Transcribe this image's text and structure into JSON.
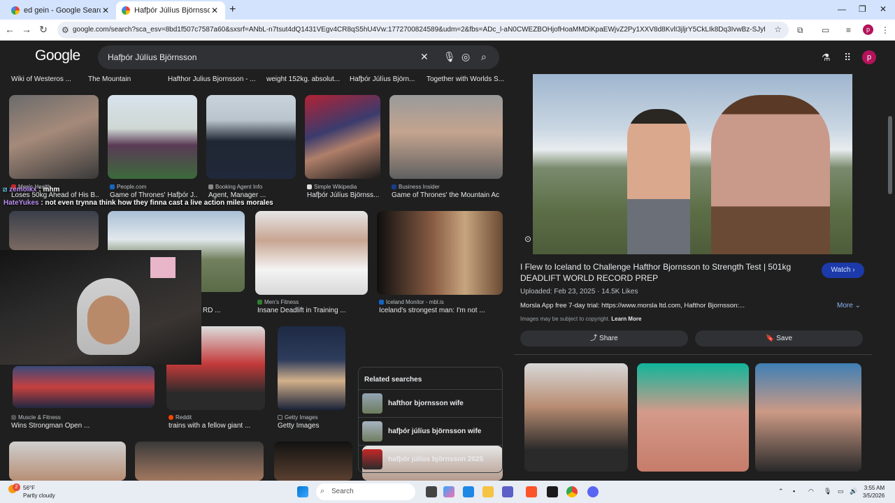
{
  "browser": {
    "tabs": [
      {
        "title": "ed gein - Google Search",
        "close": "✕"
      },
      {
        "title": "Hafþór Júlíus Björnsson - Goog",
        "close": "✕"
      }
    ],
    "new_tab": "+",
    "url": "google.com/search?sca_esv=8bd1f507c7587a60&sxsrf=ANbL-n7tsut4dQ1431VEgv4CR8qS5hU4Vw:1772700824589&udm=2&fbs=ADc_l-aN0CWEZBOHjofHoaMMDiKpaEWjvZ2Py1XXV8d8KvlI3jljrY5CkLIk8Dq3IvwBz-SJyfRX_inP-J3Cs9lQZu9J3...",
    "profile_initial": "p"
  },
  "google": {
    "logo": "Google",
    "query": "Hafþór Júlíus Björnsson",
    "avatar_initial": "p"
  },
  "chips": [
    "Wiki of Westeros ...",
    "The Mountain",
    "Hafthor Julius Bjornsson - ...",
    "weight 152kg. absolut...",
    "Hafþór Júlíus Björn...",
    "Together with Worlds S..."
  ],
  "results": {
    "row1": [
      {
        "source": "Men's Health",
        "caption": "Loses 50kg Ahead of His B..."
      },
      {
        "source": "People.com",
        "caption": "Game of Thrones' Hafþór J..."
      },
      {
        "source": "Booking Agent Info",
        "caption": "Agent, Manager ..."
      },
      {
        "source": "Simple Wikipedia",
        "caption": "Hafþór Júlíus Björnss..."
      },
      {
        "source": "Business Insider",
        "caption": "Game of Thrones' the Mountain Ac..."
      }
    ],
    "row2": [
      {
        "source": "",
        "caption": "RD ..."
      },
      {
        "source": "Men's Fitness",
        "caption": "Insane Deadlift in Training ..."
      },
      {
        "source": "Iceland Monitor - mbl.is",
        "caption": "Iceland's strongest man: I'm not ..."
      }
    ],
    "row3": [
      {
        "source": "Muscle & Fitness",
        "caption": "Wins Strongman Open ..."
      },
      {
        "source": "Reddit",
        "caption": "trains with a fellow giant ..."
      },
      {
        "source": "Getty Images",
        "caption": "Getty Images"
      }
    ]
  },
  "chat": [
    {
      "name": "zemolkx",
      "msg": "mhm"
    },
    {
      "name": "HateYukes",
      "msg": "not even trynna think how they finna cast a live action miles morales"
    }
  ],
  "related": {
    "heading": "Related searches",
    "items": [
      {
        "plain": "hafthor bjornsson wife",
        "bold": ""
      },
      {
        "plain": "hafþór júlíus björnsson ",
        "bold": "wife"
      },
      {
        "plain": "hafþór júlíus björnsson ",
        "bold": "2025"
      }
    ]
  },
  "panel": {
    "title": "I Flew to Iceland to Challenge Hafthor Bjornsson to Strength Test | 501kg DEADLIFT WORLD RECORD PREP",
    "watch": "Watch",
    "meta": "Uploaded: Feb 23, 2025 · 14.5K Likes",
    "desc": "Morsla App free 7-day trial: https://www.morsla ltd.com, Hafthor Bjornsson:...",
    "more": "More",
    "copyright": "Images may be subject to copyright.",
    "learn_more": "Learn More",
    "share": "Share",
    "save": "Save"
  },
  "taskbar": {
    "temp": "56°F",
    "condition": "Partly cloudy",
    "badge": "2",
    "search": "Search",
    "time": "3:55 AM",
    "date": "3/5/2026"
  },
  "colors": {
    "accent": "#8ab4f8",
    "watch_bg": "#1c3aa9",
    "page_bg": "#1f1f1f"
  }
}
